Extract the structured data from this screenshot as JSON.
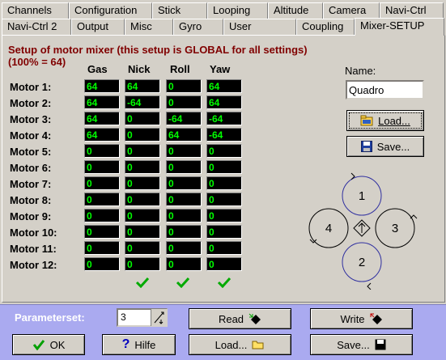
{
  "tabs_row1": [
    "Channels",
    "Configuration",
    "Stick",
    "Looping",
    "Altitude",
    "Camera",
    "Navi-Ctrl"
  ],
  "tabs_row2": [
    "Navi-Ctrl 2",
    "Output",
    "Misc",
    "Gyro",
    "User",
    "Coupling",
    "Mixer-SETUP"
  ],
  "active_tab": "Mixer-SETUP",
  "mixer": {
    "title_line1": "Setup of motor mixer (this setup is GLOBAL for all settings)",
    "title_line2": "(100% = 64)",
    "columns": [
      "Gas",
      "Nick",
      "Roll",
      "Yaw"
    ],
    "motors": [
      {
        "label": "Motor 1:",
        "values": [
          "64",
          "64",
          "0",
          "64"
        ]
      },
      {
        "label": "Motor 2:",
        "values": [
          "64",
          "-64",
          "0",
          "64"
        ]
      },
      {
        "label": "Motor 3:",
        "values": [
          "64",
          "0",
          "-64",
          "-64"
        ]
      },
      {
        "label": "Motor 4:",
        "values": [
          "64",
          "0",
          "64",
          "-64"
        ]
      },
      {
        "label": "Motor 5:",
        "values": [
          "0",
          "0",
          "0",
          "0"
        ]
      },
      {
        "label": "Motor 6:",
        "values": [
          "0",
          "0",
          "0",
          "0"
        ]
      },
      {
        "label": "Motor 7:",
        "values": [
          "0",
          "0",
          "0",
          "0"
        ]
      },
      {
        "label": "Motor 8:",
        "values": [
          "0",
          "0",
          "0",
          "0"
        ]
      },
      {
        "label": "Motor 9:",
        "values": [
          "0",
          "0",
          "0",
          "0"
        ]
      },
      {
        "label": "Motor 10:",
        "values": [
          "0",
          "0",
          "0",
          "0"
        ]
      },
      {
        "label": "Motor 11:",
        "values": [
          "0",
          "0",
          "0",
          "0"
        ]
      },
      {
        "label": "Motor 12:",
        "values": [
          "0",
          "0",
          "0",
          "0"
        ]
      }
    ]
  },
  "name": {
    "label": "Name:",
    "value": "Quadro"
  },
  "buttons": {
    "load": "Load...",
    "save": "Save...",
    "read": "Read",
    "write": "Write",
    "ok": "OK",
    "help": "Hilfe",
    "load_bottom": "Load...",
    "save_bottom": "Save..."
  },
  "diagram": {
    "motor1": "1",
    "motor2": "2",
    "motor3": "3",
    "motor4": "4"
  },
  "parameterset": {
    "label": "Parameterset:",
    "value": "3"
  },
  "colors": {
    "accent": "#aaaaf0",
    "title": "#800000",
    "cell_text": "#00ff00",
    "check": "#00aa00"
  }
}
